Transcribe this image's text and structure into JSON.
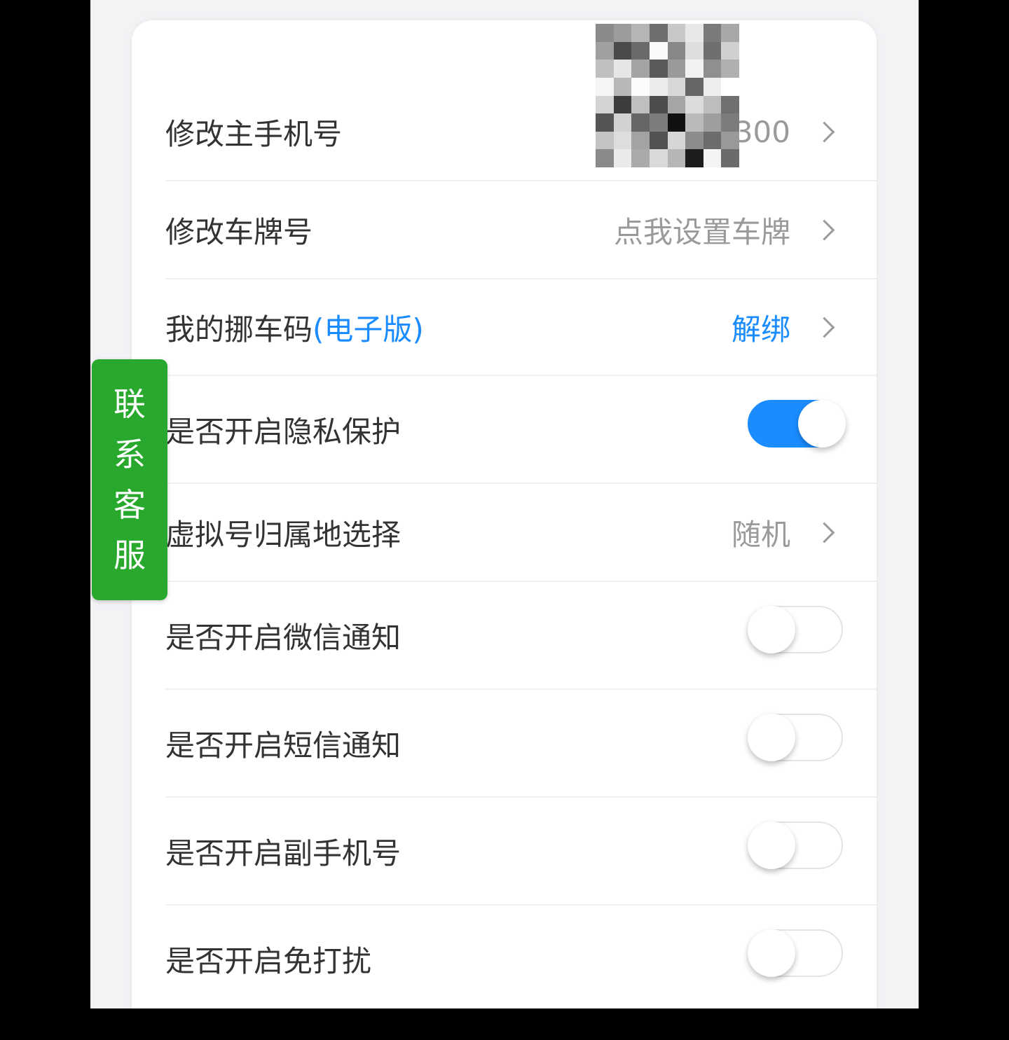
{
  "settings": {
    "rows": [
      {
        "label": "修改主手机号",
        "value": "300"
      },
      {
        "label": "修改车牌号",
        "value": "点我设置车牌"
      },
      {
        "label_main": "我的挪车码",
        "label_accent": "(电子版)",
        "value": "解绑"
      },
      {
        "label": "是否开启隐私保护",
        "toggle": "on"
      },
      {
        "label": "虚拟号归属地选择",
        "value": "随机"
      },
      {
        "label": "是否开启微信通知",
        "toggle": "off"
      },
      {
        "label": "是否开启短信通知",
        "toggle": "off"
      },
      {
        "label": "是否开启副手机号",
        "toggle": "off"
      },
      {
        "label": "是否开启免打扰",
        "toggle": "off"
      }
    ]
  },
  "contact_service": {
    "chars": [
      "联",
      "系",
      "客",
      "服"
    ]
  },
  "colors": {
    "accent": "#1a8cff",
    "contact_green": "#28a92e",
    "caption_yellow": "#ffe400"
  },
  "icons": {
    "chevron": "chevron-right-icon",
    "mosaic": "pixelated-mosaic"
  }
}
